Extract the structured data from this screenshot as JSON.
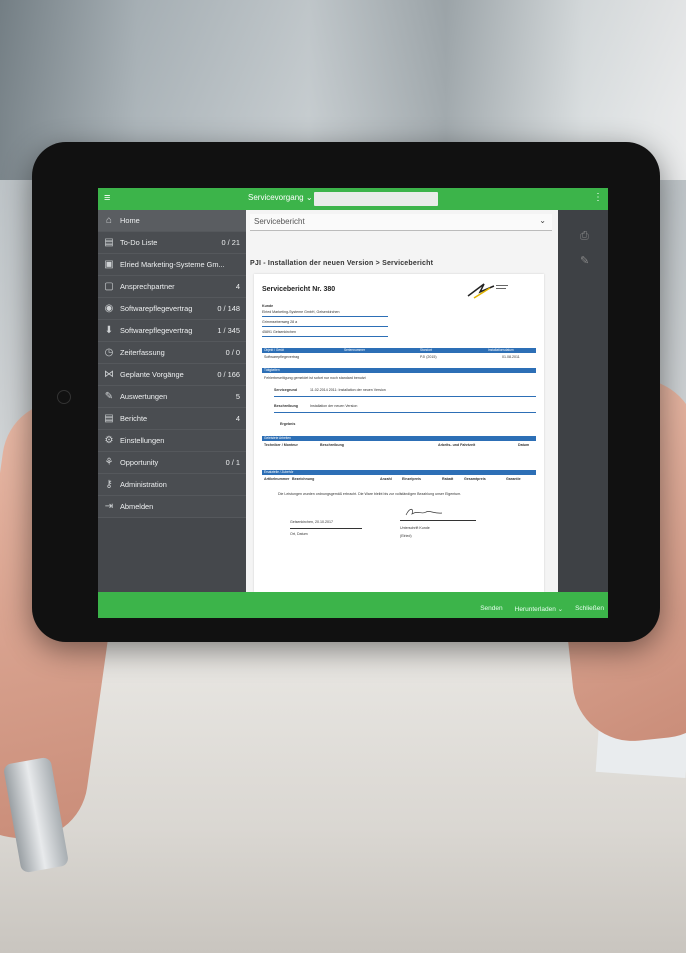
{
  "header": {
    "menu_icon": "hamburger-icon",
    "dropdown_label": "Servicevorgang",
    "right_icon": "menu-dots-icon"
  },
  "sidebar": {
    "items": [
      {
        "icon": "home-icon",
        "label": "Home",
        "count": ""
      },
      {
        "icon": "todo-icon",
        "label": "To-Do Liste",
        "count": "0 / 21"
      },
      {
        "icon": "company-icon",
        "label": "Elried Marketing-Systeme Gm...",
        "count": ""
      },
      {
        "icon": "contact-icon",
        "label": "Ansprechpartner",
        "count": "4"
      },
      {
        "icon": "gear-icon",
        "label": "Softwarepflegevertrag",
        "count": "0 / 148"
      },
      {
        "icon": "download-icon",
        "label": "Softwarepflegevertrag",
        "count": "1 / 345"
      },
      {
        "icon": "clock-icon",
        "label": "Zeiterfassung",
        "count": "0 / 0"
      },
      {
        "icon": "share-icon",
        "label": "Geplante Vorgänge",
        "count": "0 / 166"
      },
      {
        "icon": "pencil-icon",
        "label": "Auswertungen",
        "count": "5"
      },
      {
        "icon": "report-icon",
        "label": "Berichte",
        "count": "4"
      },
      {
        "icon": "settings-icon",
        "label": "Einstellungen",
        "count": ""
      },
      {
        "icon": "opportunity-icon",
        "label": "Opportunity",
        "count": "0 / 1"
      },
      {
        "icon": "admin-icon",
        "label": "Administration",
        "count": ""
      },
      {
        "icon": "logout-icon",
        "label": "Abmelden",
        "count": ""
      }
    ]
  },
  "content": {
    "report_select": "Servicebericht",
    "breadcrumb": "PJI - Installation der neuen Version > Servicebericht",
    "paper": {
      "title": "Servicebericht Nr. 380",
      "kunde_label": "Kunde",
      "kunde_name": "Elried Marketing-Systeme GmbH, Gelsenkirchen",
      "address1": "Grimmsebenweg 28 a",
      "address2": "45891 Gelsenkirchen",
      "table1_headers": [
        "Objekt / Gerät",
        "Seriennummer",
        "Standort",
        "Installationsdatum"
      ],
      "table1_row": [
        "Softwarepflegevertrag",
        "",
        "PJI (2015)",
        "01.08.2011"
      ],
      "section_title": "Tätigkeiten",
      "section_text": "Fehlerbeseitigung gemeldet ist sofort nur noch standard benutzt",
      "servicegrund_label": "Servicegrund",
      "servicegrund_value": "11.02.2014 2011: Installation der neuen Version",
      "beschreibung_label": "Beschreibung",
      "beschreibung_value": "Installation der neuen Version",
      "ergebnis_label": "Ergebnis",
      "table2_title": "Geleistete Arbeiten",
      "table2_headers": [
        "Techniker / Monteur",
        "Beschreibung",
        "Arbeits- und Fahrtzeit",
        "Datum"
      ],
      "table3_title": "Ersatzteile / Zubehör",
      "table3_headers": [
        "Artikelnummer",
        "Bezeichnung",
        "Anzahl",
        "Einzelpreis",
        "Rabatt",
        "Gesamtpreis",
        "Garantie"
      ],
      "note": "Die Leistungen wurden ordnungsgemäß erbracht. Die Ware bleibt bis zur vollständigen Bezahlung unser Eigentum.",
      "place_date": "Gelsenkirchen, 20.10.2017",
      "place_date_label": "Ort, Datum",
      "sign_label": "Unterschrift Kunde",
      "sign_name": "(Elried)"
    }
  },
  "footer": {
    "items": [
      "Senden",
      "Herunterladen",
      "Schließen"
    ]
  },
  "right_icons": [
    "printer-icon",
    "edit-icon"
  ]
}
